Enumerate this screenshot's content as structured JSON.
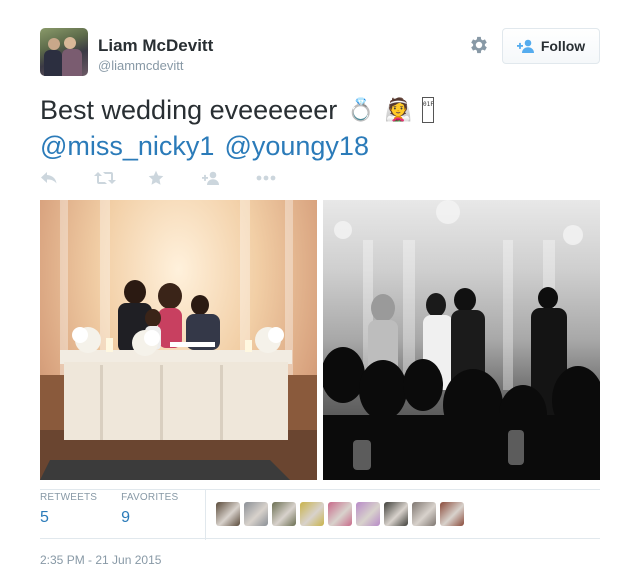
{
  "user": {
    "name": "Liam McDevitt",
    "handle": "@liammcdevitt"
  },
  "follow_button": {
    "label": "Follow"
  },
  "tweet": {
    "line1_text": "Best wedding eveeeeeer",
    "emoji_ring": "💍",
    "emoji_bride": "👰",
    "emoji_unknown": "01F3FC",
    "mentions": [
      "@miss_nicky1",
      "@youngy18"
    ]
  },
  "actions": [
    "reply-icon",
    "retweet-icon",
    "favorite-icon",
    "follow-icon",
    "more-icon"
  ],
  "stats": {
    "retweets_label": "RETWEETS",
    "retweets_value": "5",
    "favorites_label": "FAVORITES",
    "favorites_value": "9"
  },
  "favoriter_avatars": [
    "#5a4a3a",
    "#8a8f96",
    "#6b6f52",
    "#c9b34a",
    "#c86a8a",
    "#b88ac8",
    "#3f3f3a",
    "#7e7670",
    "#8a4a3a"
  ],
  "timestamp": "2:35 PM - 21 Jun 2015",
  "colors": {
    "link": "#2b7bb9",
    "muted": "#8899a6",
    "text": "#292f33",
    "border": "#e1e8ed"
  }
}
